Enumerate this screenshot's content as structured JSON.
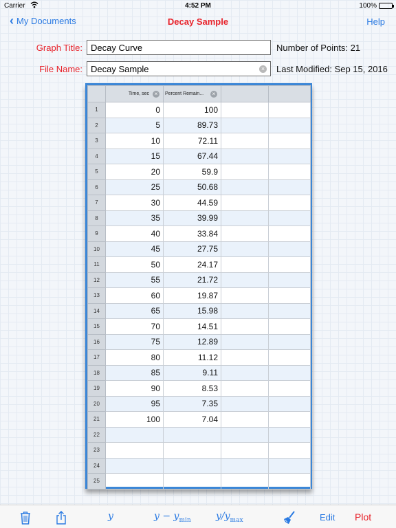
{
  "status_bar": {
    "carrier": "Carrier",
    "time": "4:52 PM",
    "battery": "100%"
  },
  "nav": {
    "back_label": "My Documents",
    "title": "Decay Sample",
    "help_label": "Help"
  },
  "form": {
    "graph_title_label": "Graph Title:",
    "graph_title_value": "Decay Curve",
    "file_name_label": "File Name:",
    "file_name_value": "Decay Sample",
    "points_text": "Number of Points: 21",
    "modified_text": "Last Modified: Sep 15, 2016"
  },
  "table": {
    "headers": [
      "Time, sec",
      "Percent Remain..."
    ],
    "rows": [
      [
        "1",
        "0",
        "100"
      ],
      [
        "2",
        "5",
        "89.73"
      ],
      [
        "3",
        "10",
        "72.11"
      ],
      [
        "4",
        "15",
        "67.44"
      ],
      [
        "5",
        "20",
        "59.9"
      ],
      [
        "6",
        "25",
        "50.68"
      ],
      [
        "7",
        "30",
        "44.59"
      ],
      [
        "8",
        "35",
        "39.99"
      ],
      [
        "9",
        "40",
        "33.84"
      ],
      [
        "10",
        "45",
        "27.75"
      ],
      [
        "11",
        "50",
        "24.17"
      ],
      [
        "12",
        "55",
        "21.72"
      ],
      [
        "13",
        "60",
        "19.87"
      ],
      [
        "14",
        "65",
        "15.98"
      ],
      [
        "15",
        "70",
        "14.51"
      ],
      [
        "16",
        "75",
        "12.89"
      ],
      [
        "17",
        "80",
        "11.12"
      ],
      [
        "18",
        "85",
        "9.11"
      ],
      [
        "19",
        "90",
        "8.53"
      ],
      [
        "20",
        "95",
        "7.35"
      ],
      [
        "21",
        "100",
        "7.04"
      ],
      [
        "22",
        "",
        ""
      ],
      [
        "23",
        "",
        ""
      ],
      [
        "24",
        "",
        ""
      ],
      [
        "25",
        "",
        ""
      ]
    ]
  },
  "toolbar": {
    "trash_icon": "trash-icon",
    "share_icon": "share-icon",
    "y_label": "y",
    "y_minus_label": "y − y",
    "y_minus_sub": "min",
    "y_div_label": "y/y",
    "y_div_sub": "max",
    "brush_icon": "brush-icon",
    "edit_label": "Edit",
    "plot_label": "Plot"
  },
  "colors": {
    "accent_blue": "#2a7ae2",
    "accent_red": "#e8232b",
    "table_border": "#3b86d6"
  }
}
